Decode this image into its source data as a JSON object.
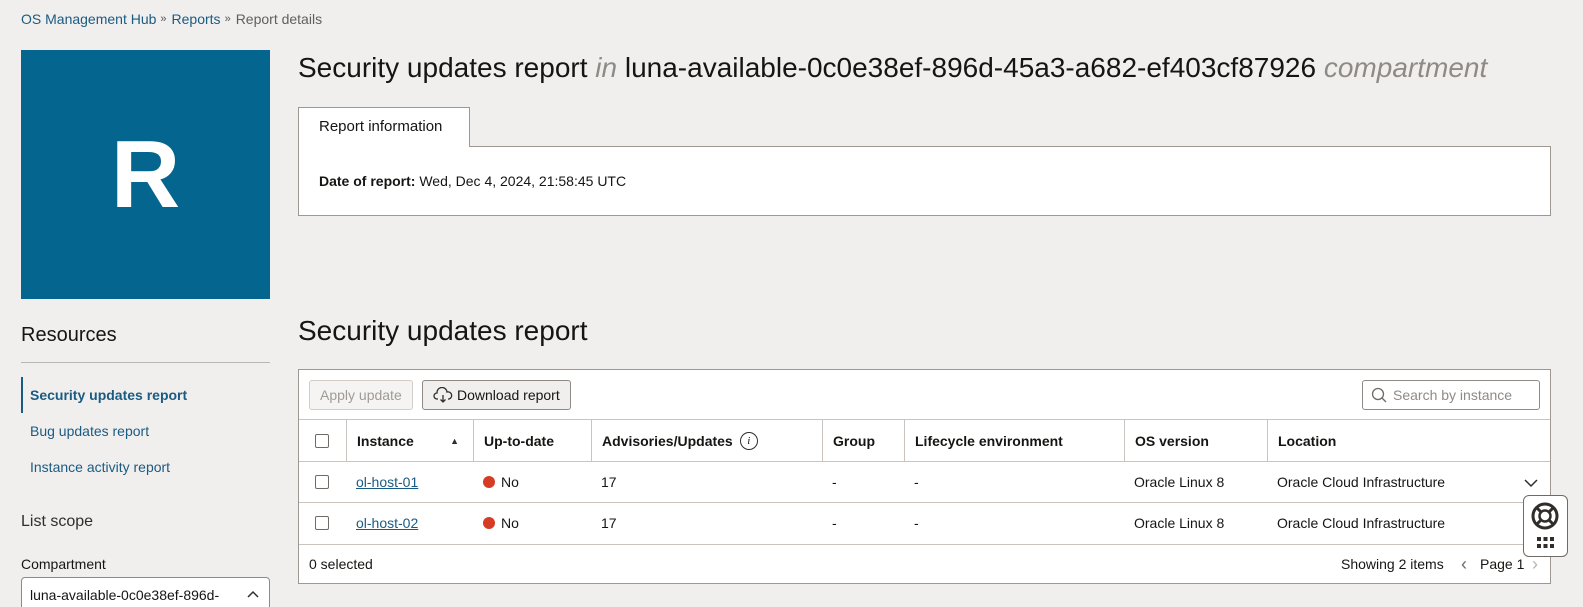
{
  "breadcrumb": {
    "items": [
      "OS Management Hub",
      "Reports"
    ],
    "current": "Report details"
  },
  "tile": {
    "letter": "R",
    "color": "#04668f"
  },
  "title": {
    "main": "Security updates report",
    "in": "in",
    "compartment_name": "luna-available-0c0e38ef-896d-45a3-a682-ef403cf87926",
    "compartment_word": "compartment"
  },
  "info_tab": {
    "label": "Report information",
    "date_label": "Date of report:",
    "date_value": "Wed, Dec 4, 2024, 21:58:45 UTC"
  },
  "sidebar": {
    "resources_heading": "Resources",
    "items": [
      {
        "label": "Security updates report",
        "active": true
      },
      {
        "label": "Bug updates report",
        "active": false
      },
      {
        "label": "Instance activity report",
        "active": false
      }
    ],
    "list_scope_heading": "List scope",
    "compartment_label": "Compartment",
    "compartment_value": "luna-available-0c0e38ef-896d-"
  },
  "section_title": "Security updates report",
  "toolbar": {
    "apply_label": "Apply update",
    "download_label": "Download report",
    "search_placeholder": "Search by instance"
  },
  "table": {
    "columns": [
      "Instance",
      "Up-to-date",
      "Advisories/Updates",
      "Group",
      "Lifecycle environment",
      "OS version",
      "Location"
    ],
    "rows": [
      {
        "instance": "ol-host-01",
        "up_to_date": "No",
        "advisories": "17",
        "group": "-",
        "lifecycle": "-",
        "os_version": "Oracle Linux 8",
        "location": "Oracle Cloud Infrastructure"
      },
      {
        "instance": "ol-host-02",
        "up_to_date": "No",
        "advisories": "17",
        "group": "-",
        "lifecycle": "-",
        "os_version": "Oracle Linux 8",
        "location": "Oracle Cloud Infrastructure"
      }
    ],
    "status_color": "#d63b25"
  },
  "footer": {
    "selected": "0 selected",
    "showing": "Showing 2 items",
    "page": "Page 1"
  },
  "icons": {
    "download": "cloud-download-icon",
    "search": "search-icon",
    "info": "info-icon",
    "sort": "sort-ascending-icon",
    "help": "help-lifebuoy-icon",
    "apps": "apps-grid-icon"
  }
}
